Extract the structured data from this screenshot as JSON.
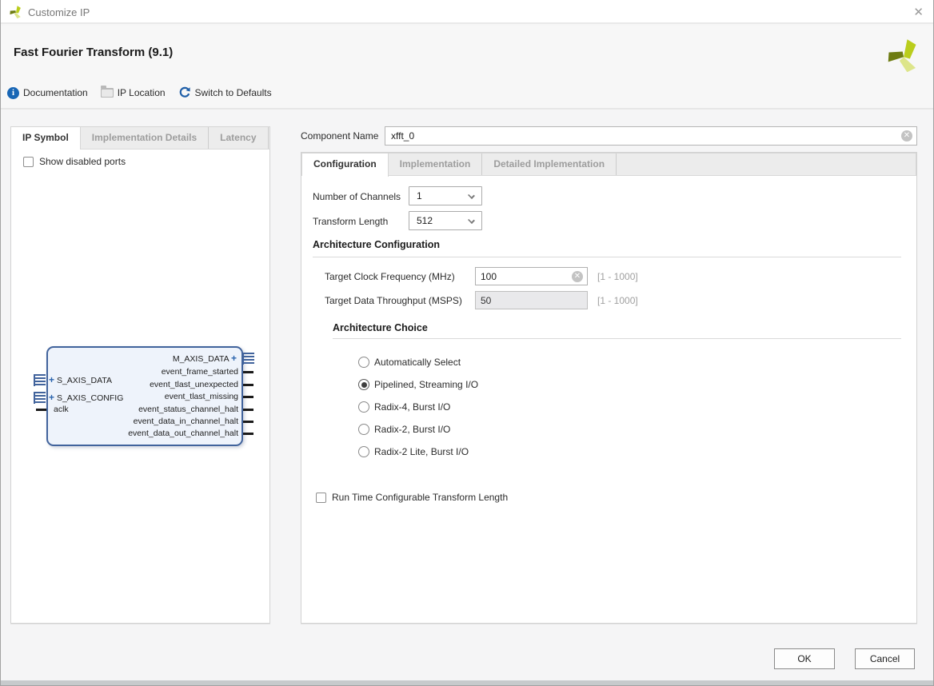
{
  "window": {
    "title": "Customize IP",
    "close_glyph": "✕"
  },
  "header": {
    "title": "Fast Fourier Transform (9.1)"
  },
  "toolbar": {
    "documentation": "Documentation",
    "ip_location": "IP Location",
    "switch_to_defaults": "Switch to Defaults",
    "info_glyph": "i"
  },
  "left": {
    "tabs": [
      {
        "label": "IP Symbol",
        "active": true
      },
      {
        "label": "Implementation Details",
        "active": false
      },
      {
        "label": "Latency",
        "active": false
      }
    ],
    "show_disabled_ports": "Show disabled ports",
    "ip_symbol": {
      "left_ports": [
        {
          "name": "S_AXIS_DATA",
          "type": "interface"
        },
        {
          "name": "S_AXIS_CONFIG",
          "type": "interface"
        },
        {
          "name": "aclk",
          "type": "pin"
        }
      ],
      "right_ports": [
        {
          "name": "M_AXIS_DATA",
          "type": "interface"
        },
        {
          "name": "event_frame_started",
          "type": "pin"
        },
        {
          "name": "event_tlast_unexpected",
          "type": "pin"
        },
        {
          "name": "event_tlast_missing",
          "type": "pin"
        },
        {
          "name": "event_status_channel_halt",
          "type": "pin"
        },
        {
          "name": "event_data_in_channel_halt",
          "type": "pin"
        },
        {
          "name": "event_data_out_channel_halt",
          "type": "pin"
        }
      ],
      "plus_glyph": "+"
    }
  },
  "component": {
    "label": "Component Name",
    "value": "xfft_0"
  },
  "right_tabs": [
    {
      "label": "Configuration",
      "active": true
    },
    {
      "label": "Implementation",
      "active": false
    },
    {
      "label": "Detailed Implementation",
      "active": false
    }
  ],
  "config": {
    "number_of_channels": {
      "label": "Number of Channels",
      "value": "1"
    },
    "transform_length": {
      "label": "Transform Length",
      "value": "512"
    },
    "arch_config": {
      "title": "Architecture Configuration",
      "clock": {
        "label": "Target Clock Frequency (MHz)",
        "value": "100",
        "range": "[1 - 1000]"
      },
      "throughput": {
        "label": "Target Data Throughput (MSPS)",
        "value": "50",
        "range": "[1 - 1000]",
        "disabled": true
      }
    },
    "arch_choice": {
      "title": "Architecture Choice",
      "options": [
        {
          "label": "Automatically Select",
          "selected": false
        },
        {
          "label": "Pipelined, Streaming I/O",
          "selected": true
        },
        {
          "label": "Radix-4, Burst I/O",
          "selected": false
        },
        {
          "label": "Radix-2, Burst I/O",
          "selected": false
        },
        {
          "label": "Radix-2 Lite, Burst I/O",
          "selected": false
        }
      ]
    },
    "runtime_length": {
      "label": "Run Time Configurable Transform Length",
      "checked": false
    }
  },
  "footer": {
    "ok": "OK",
    "cancel": "Cancel"
  },
  "colors": {
    "accent_blue": "#1866b5",
    "block_border": "#41639c",
    "block_fill": "#eef3fb",
    "xilinx_bright": "#bacd1c",
    "xilinx_pale": "#dde58a",
    "xilinx_dark": "#6e7c12",
    "inactive_tab_text": "#9d9d9d",
    "panel_bg": "#ffffff",
    "content_bg": "#f5f5f6"
  }
}
